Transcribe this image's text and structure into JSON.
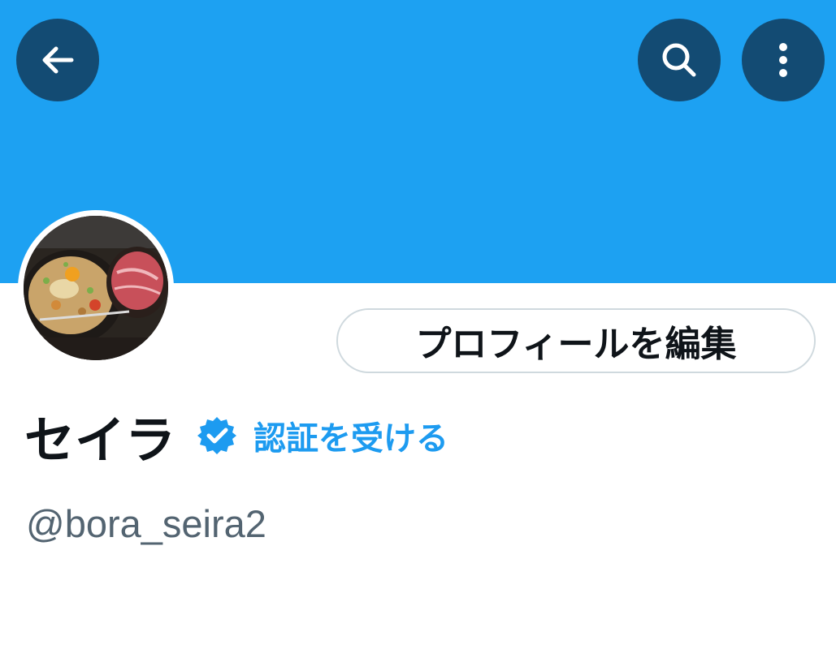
{
  "header": {
    "banner_color": "#1da1f2",
    "button_color": "#134b73",
    "back_icon": "arrow-left-icon",
    "search_icon": "search-icon",
    "more_icon": "more-vertical-icon"
  },
  "profile": {
    "avatar_description": "food-photo-avatar",
    "edit_profile_label": "プロフィールを編集",
    "display_name": "セイラ",
    "verified_badge_icon": "verified-badge-icon",
    "get_verified_label": "認証を受ける",
    "handle": "@bora_seira2"
  },
  "colors": {
    "accent": "#1d9bf0",
    "text_primary": "#0f1419",
    "text_secondary": "#536471"
  }
}
